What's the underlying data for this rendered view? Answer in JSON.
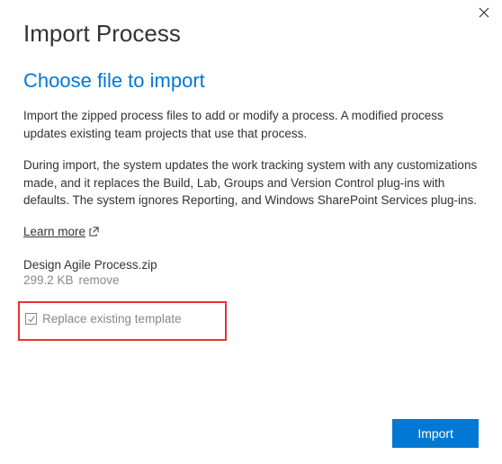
{
  "dialog": {
    "title": "Import Process",
    "section_heading": "Choose file to import",
    "paragraph1": "Import the zipped process files to add or modify a process. A modified process updates existing team projects that use that process.",
    "paragraph2": "During import, the system updates the work tracking system with any customizations made, and it replaces the Build, Lab, Groups and Version Control plug-ins with defaults. The system ignores Reporting, and Windows SharePoint Services plug-ins.",
    "learn_more": "Learn more"
  },
  "file": {
    "name": "Design Agile Process.zip",
    "size": "299.2 KB",
    "remove_label": "remove"
  },
  "checkbox": {
    "label": "Replace existing template",
    "checked": true
  },
  "actions": {
    "import_label": "Import"
  }
}
